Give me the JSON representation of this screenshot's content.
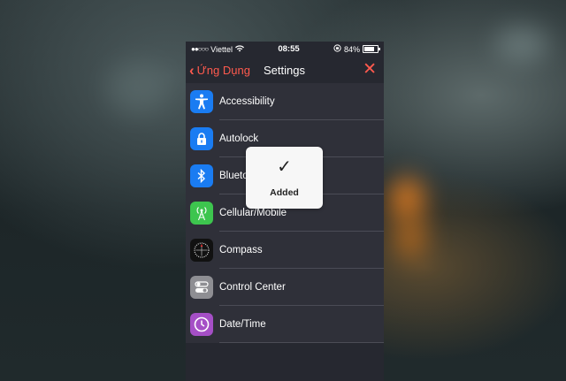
{
  "status_bar": {
    "signal": "●●○○○",
    "carrier": "Viettel",
    "wifi_icon": "wifi-icon",
    "time": "08:55",
    "battery_percent": "84%"
  },
  "nav": {
    "back_label": "Ứng Dụng",
    "title": "Settings",
    "close_glyph": "✕"
  },
  "settings_items": [
    {
      "label": "Accessibility",
      "icon": "accessibility-icon",
      "color": "#1a7cf2"
    },
    {
      "label": "Autolock",
      "icon": "lock-icon",
      "color": "#1a7cf2"
    },
    {
      "label": "Bluetooth",
      "icon": "bluetooth-icon",
      "color": "#1a7cf2"
    },
    {
      "label": "Cellular/Mobile",
      "icon": "cellular-icon",
      "color": "#3dc54e"
    },
    {
      "label": "Compass",
      "icon": "compass-icon",
      "color": "#111111"
    },
    {
      "label": "Control Center",
      "icon": "toggles-icon",
      "color": "#8e8e93"
    },
    {
      "label": "Date/Time",
      "icon": "clock-icon",
      "color": "#a54fc6"
    }
  ],
  "toast": {
    "check_glyph": "✓",
    "message": "Added"
  },
  "colors": {
    "accent": "#ff5a4e",
    "background": "#262830"
  }
}
